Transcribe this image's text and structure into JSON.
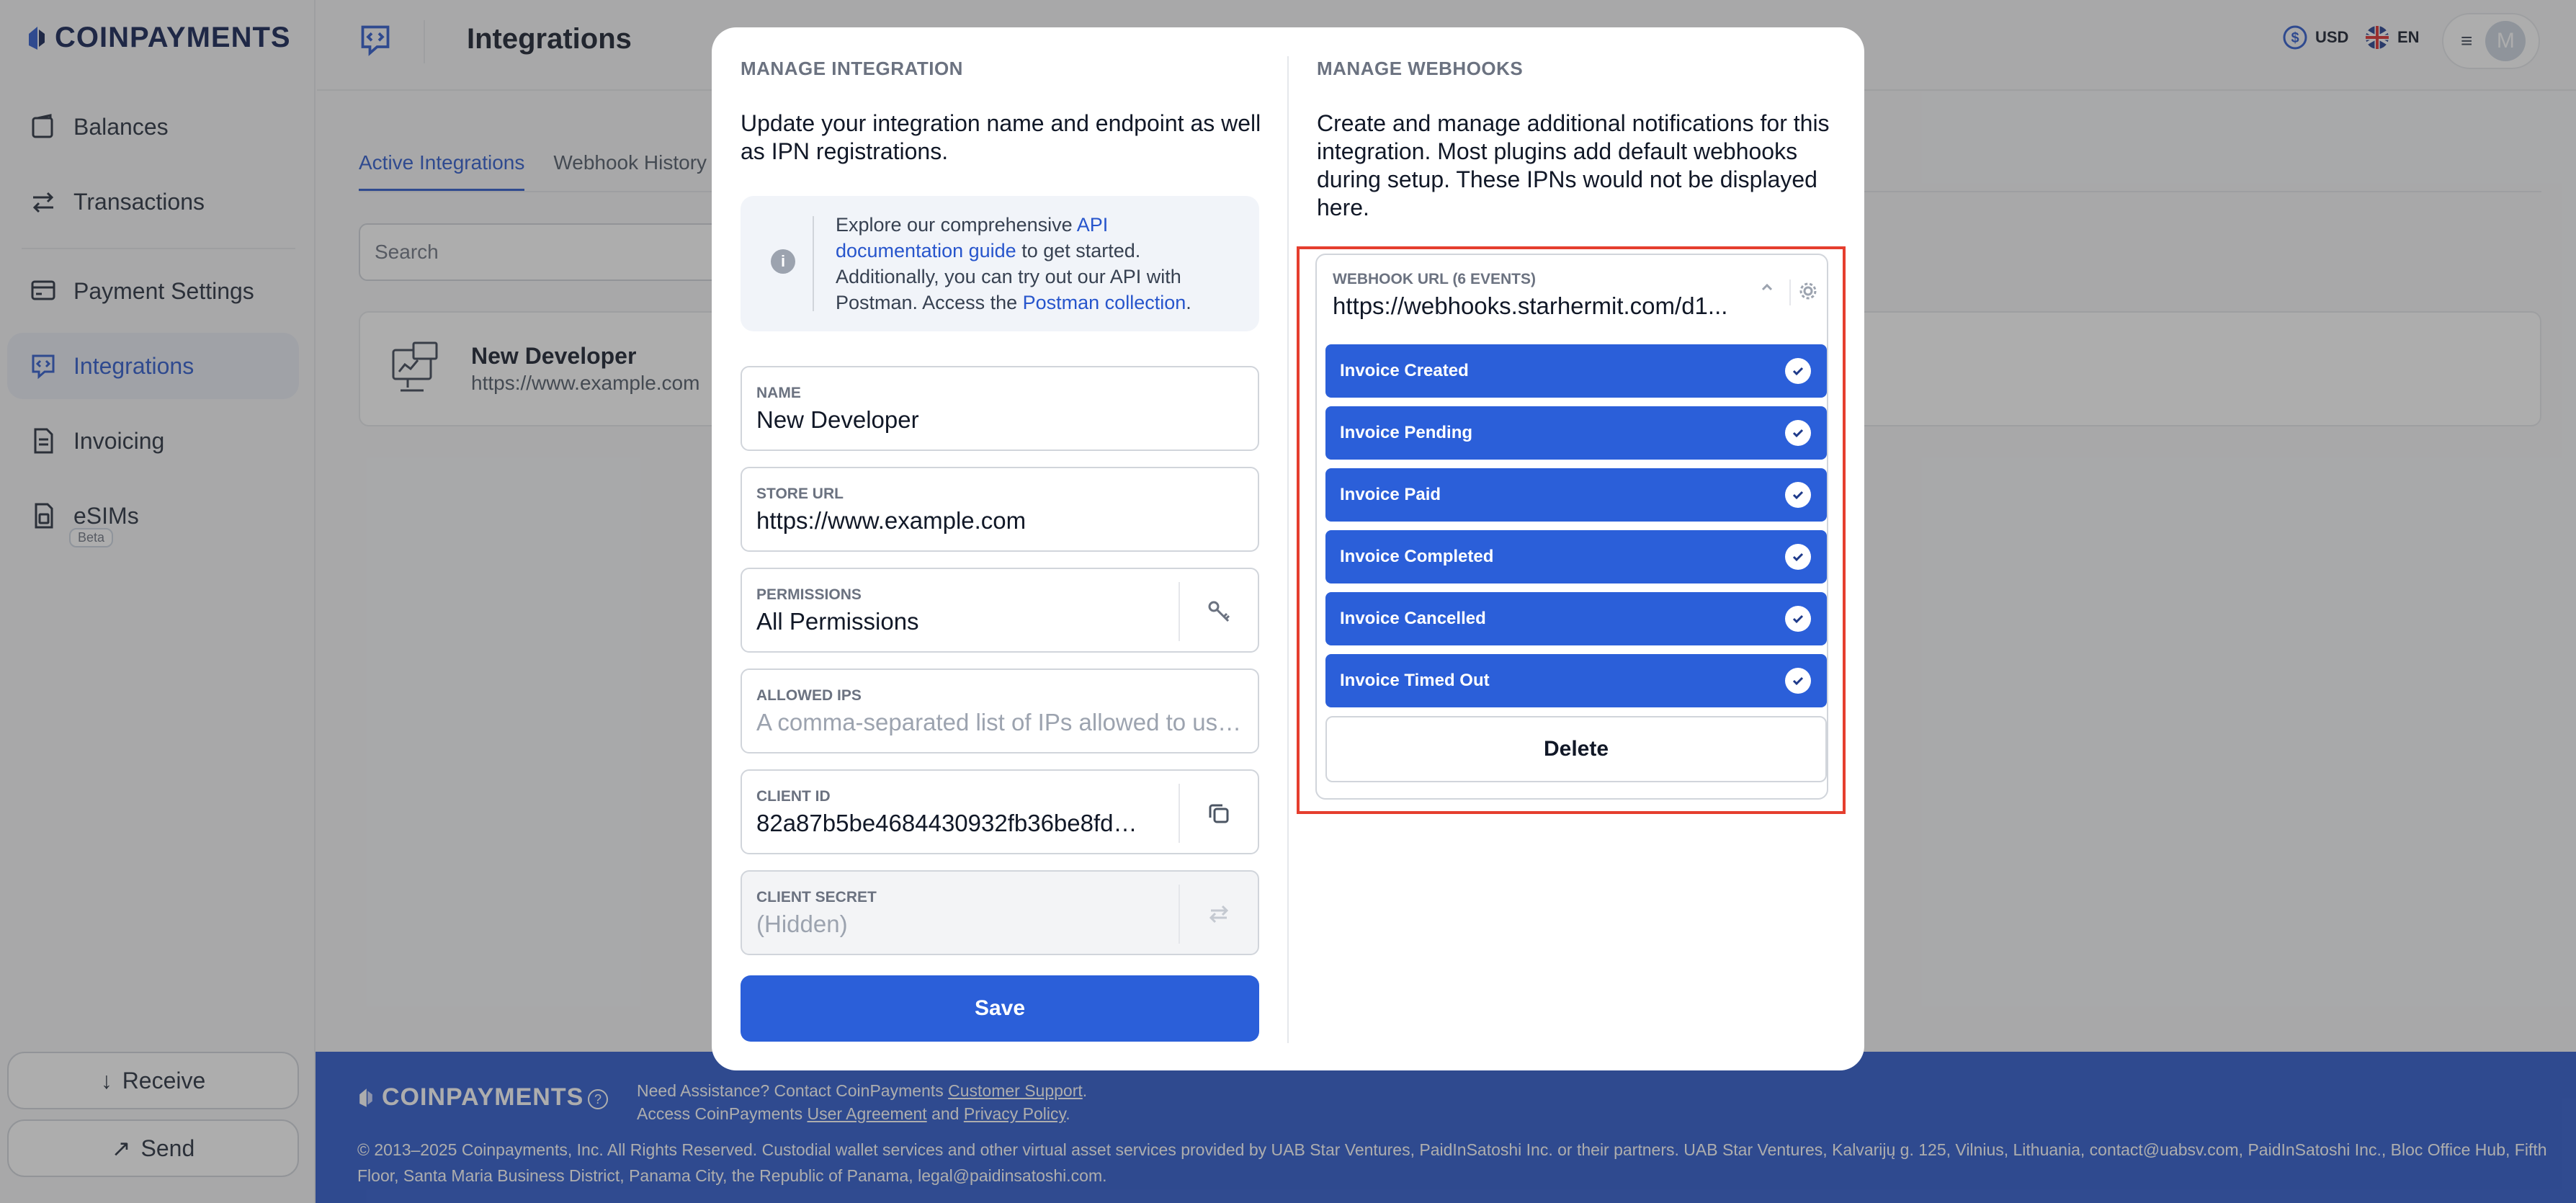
{
  "brand": {
    "name": "COINPAYMENTS"
  },
  "sidebar": {
    "items": [
      {
        "label": "Balances"
      },
      {
        "label": "Transactions"
      },
      {
        "label": "Payment Settings"
      },
      {
        "label": "Integrations"
      },
      {
        "label": "Invoicing"
      },
      {
        "label": "eSIMs",
        "badge": "Beta"
      }
    ],
    "receive_label": "Receive",
    "send_label": "Send"
  },
  "header": {
    "title": "Integrations",
    "currency": "USD",
    "language": "EN",
    "avatar_initial": "M"
  },
  "tabs": [
    {
      "label": "Active Integrations",
      "active": true
    },
    {
      "label": "Webhook History",
      "active": false
    }
  ],
  "search": {
    "placeholder": "Search"
  },
  "integration_card": {
    "name": "New Developer",
    "url": "https://www.example.com"
  },
  "modal": {
    "left": {
      "title": "MANAGE INTEGRATION",
      "description": "Update your integration name and endpoint as well as IPN registrations.",
      "info": {
        "t1": "Explore our comprehensive ",
        "link1": "API documentation guide",
        "t2": " to get started. Additionally, you can try out our API with Postman. Access the ",
        "link2": "Postman collection",
        "t3": "."
      },
      "fields": {
        "name": {
          "label": "NAME",
          "value": "New Developer"
        },
        "store_url": {
          "label": "STORE URL",
          "value": "https://www.example.com"
        },
        "permissions": {
          "label": "PERMISSIONS",
          "value": "All Permissions"
        },
        "allowed_ips": {
          "label": "ALLOWED IPS",
          "placeholder": "A comma-separated list of IPs allowed to use..."
        },
        "client_id": {
          "label": "CLIENT ID",
          "value": "82a87b5be4684430932fb36be8fd42..."
        },
        "client_secret": {
          "label": "CLIENT SECRET",
          "value": "(Hidden)"
        }
      },
      "save_label": "Save"
    },
    "right": {
      "title": "MANAGE WEBHOOKS",
      "description": "Create and manage additional notifications for this integration. Most plugins add default webhooks during setup. These IPNs would not be displayed here.",
      "webhook": {
        "label": "WEBHOOK URL (6 EVENTS)",
        "url": "https://webhooks.starhermit.com/d1...",
        "events": [
          {
            "label": "Invoice Created",
            "checked": true
          },
          {
            "label": "Invoice Pending",
            "checked": true
          },
          {
            "label": "Invoice Paid",
            "checked": true
          },
          {
            "label": "Invoice Completed",
            "checked": true
          },
          {
            "label": "Invoice Cancelled",
            "checked": true
          },
          {
            "label": "Invoice Timed Out",
            "checked": true
          }
        ],
        "delete_label": "Delete"
      }
    }
  },
  "footer": {
    "brand": "COINPAYMENTS",
    "help_prefix": "Need Assistance? Contact CoinPayments ",
    "support_link": "Customer Support",
    "help_suffix": ".",
    "access_prefix": "Access CoinPayments ",
    "agreement_link": "User Agreement",
    "and": " and ",
    "privacy_link": "Privacy Policy",
    "access_suffix": ".",
    "copyright": "© 2013–2025 Coinpayments, Inc. All Rights Reserved. Custodial wallet services and other virtual asset services provided by UAB Star Ventures, PaidInSatoshi Inc. or their partners. UAB Star Ventures, Kalvarijų g. 125, Vilnius, Lithuania, contact@uabsv.com, PaidInSatoshi Inc., Bloc Office Hub, Fifth Floor, Santa Maria Business District, Panama City, the Republic of Panama, legal@paidinsatoshi.com."
  },
  "colors": {
    "accent": "#2B5FD9",
    "highlight": "#E53E2E",
    "footer": "#2755CC"
  }
}
